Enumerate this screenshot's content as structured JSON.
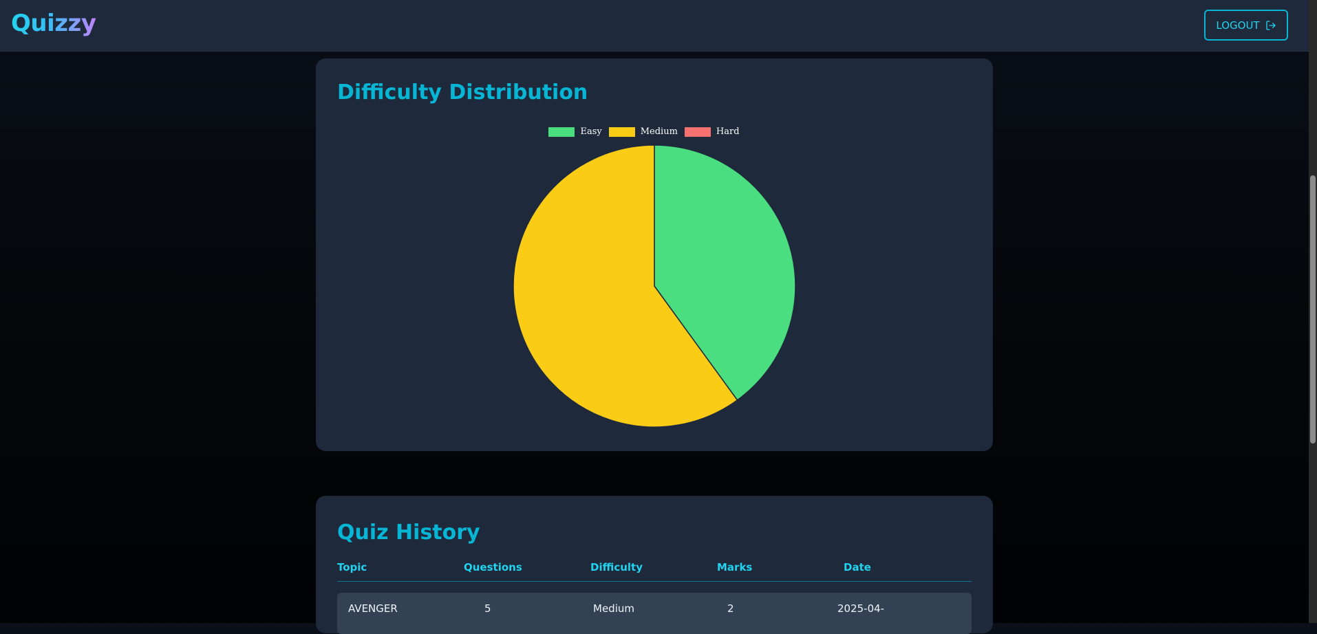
{
  "navbar": {
    "logo": "Quizzy",
    "logout_label": "LOGOUT",
    "logout_icon": "logout-icon"
  },
  "difficulty_card": {
    "title": "Difficulty Distribution",
    "chart_data": {
      "type": "pie",
      "categories": [
        "Easy",
        "Medium",
        "Hard"
      ],
      "values": [
        40,
        60,
        0
      ],
      "colors": [
        "#4ade80",
        "#facc15",
        "#f87171"
      ],
      "legend": "top"
    }
  },
  "history_card": {
    "title": "Quiz History",
    "columns": [
      "Topic",
      "Questions",
      "Difficulty",
      "Marks",
      "Date"
    ],
    "rows": [
      [
        "AVENGER",
        "5",
        "Medium",
        "2",
        "2025-04-"
      ]
    ]
  }
}
